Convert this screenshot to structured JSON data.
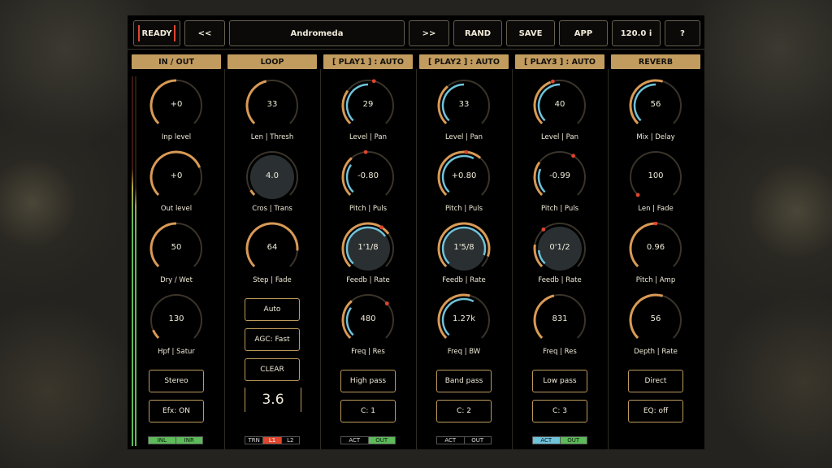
{
  "toolbar": {
    "ready": "READY",
    "prev": "<<",
    "preset_name": "Andromeda",
    "next": ">>",
    "rand": "RAND",
    "save": "SAVE",
    "app": "APP",
    "tempo": "120.0 i",
    "help": "?"
  },
  "columns": {
    "inout": {
      "header": "IN / OUT",
      "knobs": [
        {
          "value": "+0",
          "label": "Inp level",
          "level": 0.5
        },
        {
          "value": "+0",
          "label": "Out level",
          "level": 0.75
        },
        {
          "value": "50",
          "label": "Dry / Wet",
          "level": 0.5
        },
        {
          "value": "130",
          "label": "Hpf | Satur",
          "level": 0.08
        }
      ],
      "buttons": [
        "Stereo",
        "Efx: ON"
      ],
      "indicators": [
        "INL",
        "INR"
      ]
    },
    "loop": {
      "header": "LOOP",
      "knobs": [
        {
          "value": "33",
          "label": "Len | Thresh",
          "level": 0.45
        },
        {
          "value": "4.0",
          "label": "Cros | Trans",
          "level": 0.05
        },
        {
          "value": "64",
          "label": "Step | Fade",
          "level": 0.85
        }
      ],
      "buttons": [
        "Auto",
        "AGC: Fast",
        "CLEAR"
      ],
      "display": "3.6",
      "indicators": [
        "TRN",
        "L1",
        "L2"
      ]
    },
    "play1": {
      "header": "[ PLAY1 ] : AUTO",
      "knobs": [
        {
          "value": "29",
          "label": "Level | Pan",
          "level": 0.3
        },
        {
          "value": "-0.80",
          "label": "Pitch | Puls",
          "level": 0.35
        },
        {
          "value": "1'1/8",
          "label": "Feedb | Rate",
          "level": 0.7
        },
        {
          "value": "480",
          "label": "Freq | Res",
          "level": 0.35
        }
      ],
      "buttons": [
        "High pass",
        "C: 1"
      ],
      "indicators": [
        "ACT",
        "OUT"
      ]
    },
    "play2": {
      "header": "[ PLAY2 ] : AUTO",
      "knobs": [
        {
          "value": "33",
          "label": "Level | Pan",
          "level": 0.35
        },
        {
          "value": "+0.80",
          "label": "Pitch | Puls",
          "level": 0.65
        },
        {
          "value": "1'5/8",
          "label": "Feedb | Rate",
          "level": 0.9
        },
        {
          "value": "1.27k",
          "label": "Freq | BW",
          "level": 0.55
        }
      ],
      "buttons": [
        "Band pass",
        "C: 2"
      ],
      "indicators": [
        "ACT",
        "OUT"
      ]
    },
    "play3": {
      "header": "[ PLAY3 ] : AUTO",
      "knobs": [
        {
          "value": "40",
          "label": "Level | Pan",
          "level": 0.42
        },
        {
          "value": "-0.99",
          "label": "Pitch | Puls",
          "level": 0.3
        },
        {
          "value": "0'1/2",
          "label": "Feedb | Rate",
          "level": 0.2
        },
        {
          "value": "831",
          "label": "Freq | Res",
          "level": 0.45
        }
      ],
      "buttons": [
        "Low pass",
        "C: 3"
      ],
      "indicators": [
        "ACT",
        "OUT"
      ]
    },
    "reverb": {
      "header": "REVERB",
      "knobs": [
        {
          "value": "56",
          "label": "Mix | Delay",
          "level": 0.56
        },
        {
          "value": "100",
          "label": "Len | Fade",
          "level": 0.0
        },
        {
          "value": "0.96",
          "label": "Pitch | Amp",
          "level": 0.5
        },
        {
          "value": "56",
          "label": "Depth | Rate",
          "level": 0.56
        }
      ],
      "buttons": [
        "Direct",
        "EQ: off"
      ]
    }
  },
  "colors": {
    "accent": "#c29c5f",
    "knob_arc": "#d99a55",
    "mod_arc": "#6fc3da",
    "red": "#e0452e",
    "green": "#5dbb5a"
  }
}
